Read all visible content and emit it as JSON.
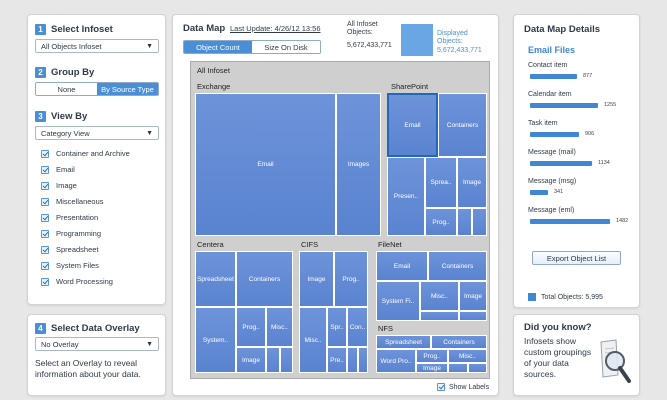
{
  "left": {
    "infoset": {
      "heading_num": "1",
      "heading": "Select Infoset",
      "selected": "All Objects Infoset"
    },
    "group_by": {
      "heading_num": "2",
      "heading": "Group By",
      "option_none": "None",
      "option_source": "By Source Type"
    },
    "view_by": {
      "heading_num": "3",
      "heading": "View By",
      "selected": "Category View",
      "categories": [
        "Container and Archive",
        "Email",
        "Image",
        "Miscellaneous",
        "Presentation",
        "Programming",
        "Spreadsheet",
        "System Files",
        "Word Processing"
      ]
    }
  },
  "overlay": {
    "heading_num": "4",
    "heading": "Select Data Overlay",
    "selected": "No Overlay",
    "description": "Select an Overlay to reveal information about your data."
  },
  "map": {
    "title": "Data Map",
    "last_update": "Last Update: 4/26/12 13:56",
    "tab_count": "Object Count",
    "tab_disk": "Size On Disk",
    "all_objects_label": "All Infoset Objects:",
    "all_objects_value": "5,672,433,771",
    "displayed_label": "Displayed Objects:",
    "displayed_value": "5,672,433,771",
    "root_label": "All Infoset",
    "groups": {
      "exchange": {
        "label": "Exchange",
        "cells": [
          "Email",
          "Images"
        ]
      },
      "sharepoint": {
        "label": "SharePoint",
        "cells": [
          "Email",
          "Containers",
          "Presen..",
          "Sprea..",
          "Image",
          "Prog.."
        ]
      },
      "centera": {
        "label": "Centera",
        "cells": [
          "Spreadsheet",
          "Containers",
          "System..",
          "Prog..",
          "Misc..",
          "Image"
        ]
      },
      "cifs": {
        "label": "CIFS",
        "cells": [
          "Image",
          "Prog..",
          "Misc..",
          "Spr..",
          "Con..",
          "Pre.."
        ]
      },
      "filenet": {
        "label": "FileNet",
        "cells": [
          "Email",
          "Containers",
          "System Fi..",
          "Misc..",
          "Image"
        ]
      },
      "nfs": {
        "label": "NFS",
        "cells": [
          "Spreadsheet",
          "Containers",
          "Word Pro..",
          "Prog..",
          "Misc..",
          "Image"
        ]
      }
    },
    "show_labels": "Show Labels"
  },
  "details": {
    "title": "Data Map Details",
    "subtitle": "Email Files",
    "items": [
      {
        "label": "Contact item",
        "value": "877",
        "fill": 0.59
      },
      {
        "label": "Calendar item",
        "value": "1255",
        "fill": 0.85
      },
      {
        "label": "Task item",
        "value": "906",
        "fill": 0.61
      },
      {
        "label": "Message (mail)",
        "value": "1134",
        "fill": 0.77
      },
      {
        "label": "Message (msg)",
        "value": "341",
        "fill": 0.23
      },
      {
        "label": "Message (eml)",
        "value": "1482",
        "fill": 1.0
      }
    ],
    "export_button": "Export Object List",
    "total": "Total Objects: 5,995"
  },
  "know": {
    "title": "Did you know?",
    "text": "Infosets show custom groupings of your data sources."
  }
}
